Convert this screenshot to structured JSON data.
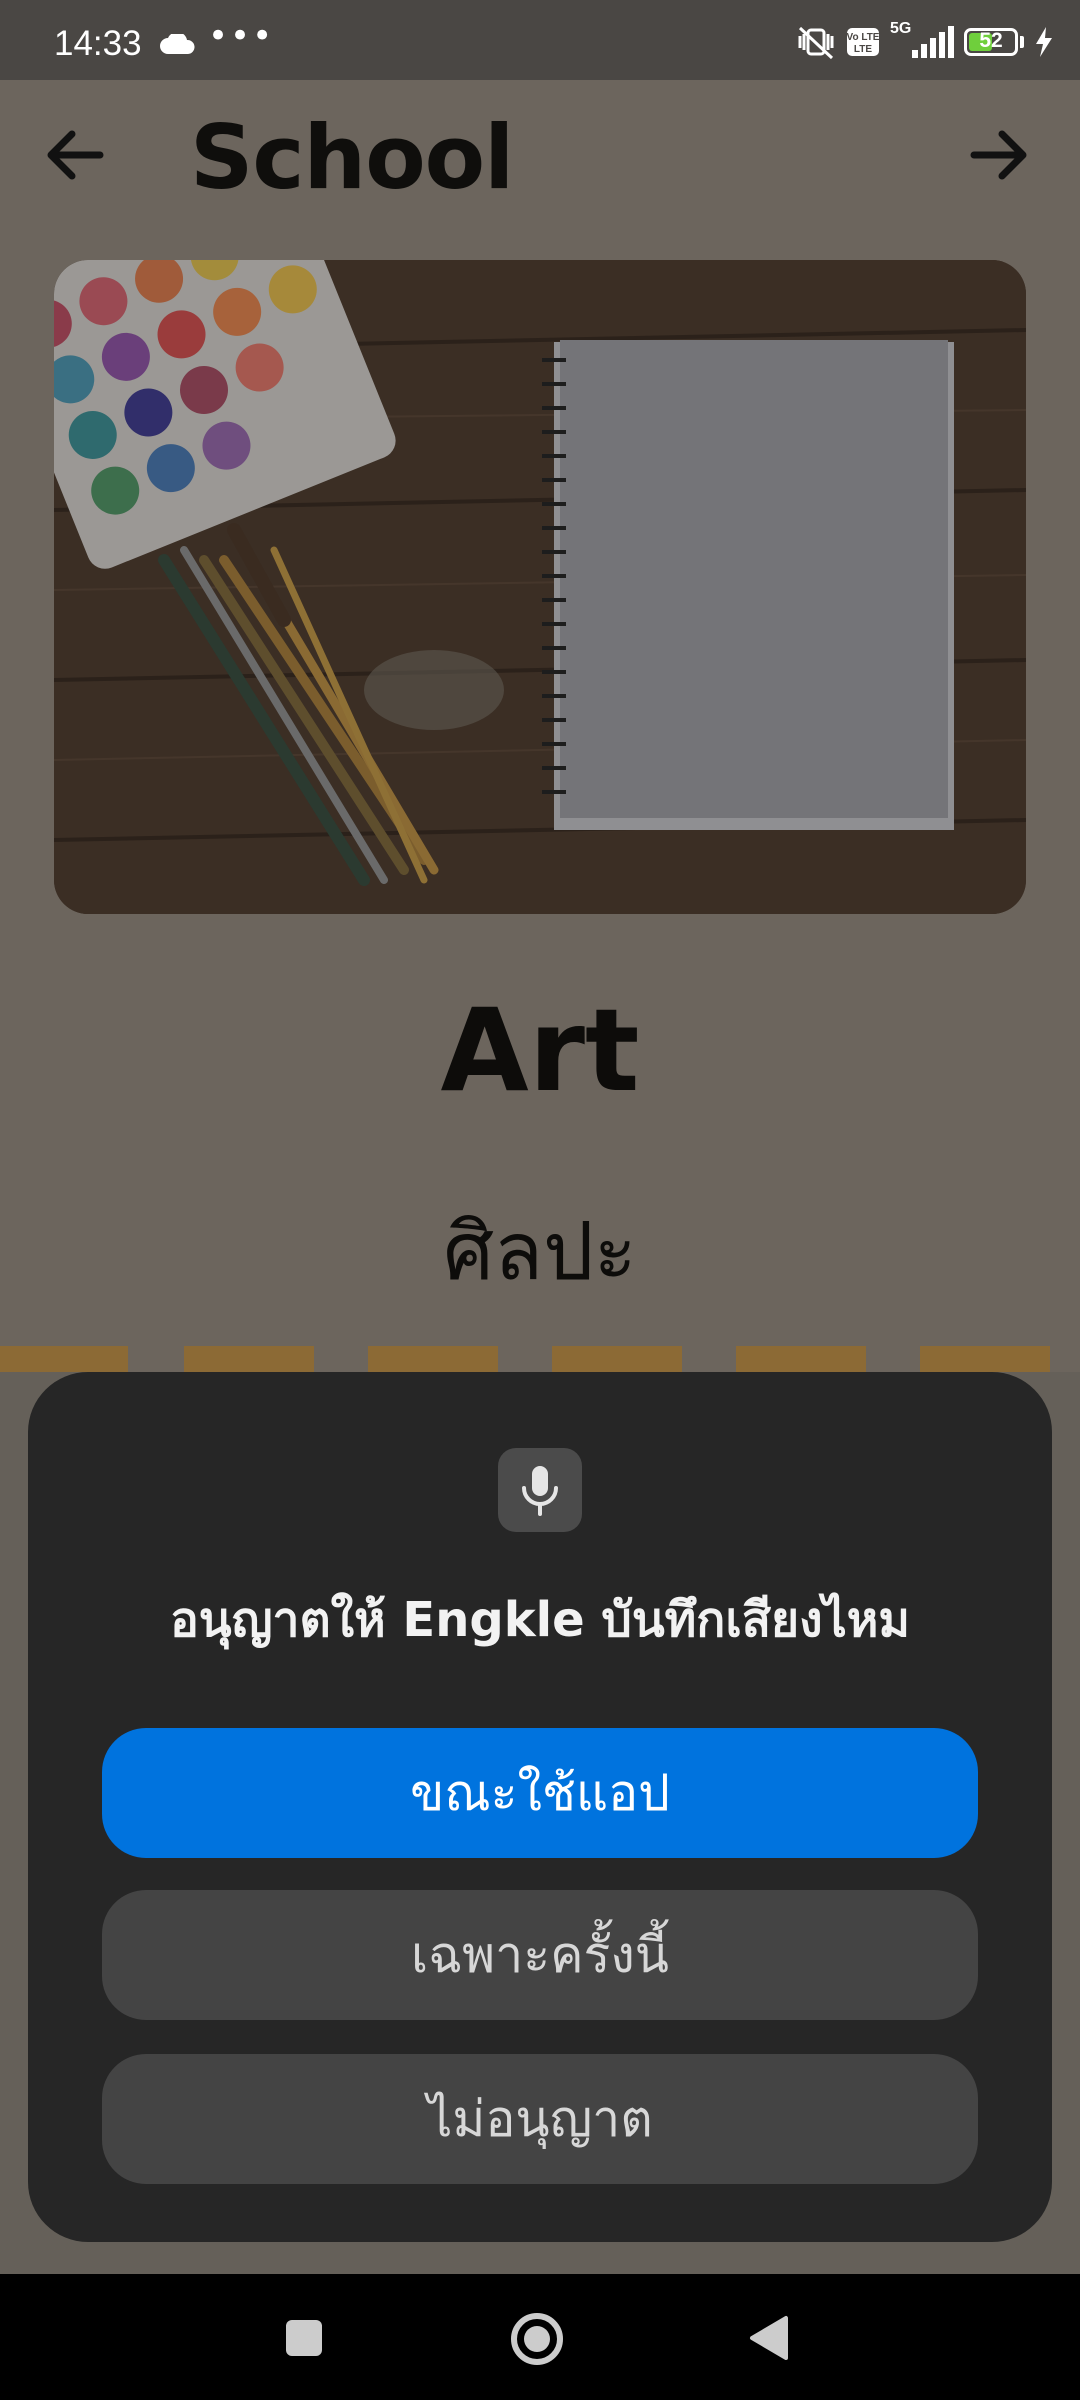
{
  "status_bar": {
    "time": "14:33",
    "more": "•••",
    "network": "5G",
    "volte": "Vo LTE",
    "battery": "52",
    "battery_level": 0.52
  },
  "app": {
    "title": "School",
    "word_english": "Art",
    "word_thai": "ศิลปะ"
  },
  "dialog": {
    "title": "อนุญาตให้ Engkle บันทึกเสียงไหม",
    "allow_while_using": "ขณะใช้แอป",
    "allow_once": "เฉพาะครั้งนี้",
    "deny": "ไม่อนุญาต"
  },
  "colors": {
    "primary_button": "#0073de",
    "dialog_bg": "#262626",
    "secondary_button": "#444444",
    "accent_dashes": "#8c6a35"
  }
}
